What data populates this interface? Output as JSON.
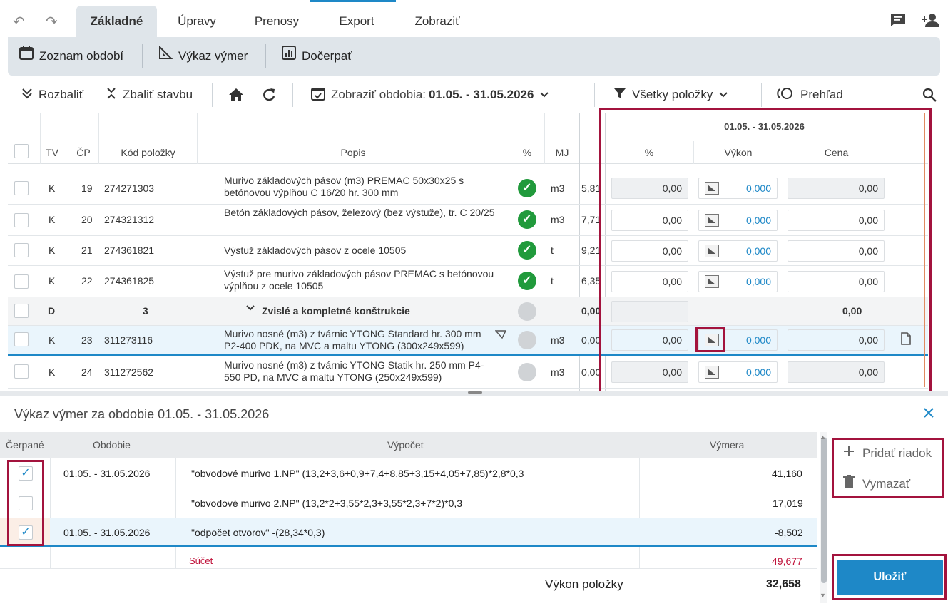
{
  "menu": {
    "tabs": [
      "Základné",
      "Úpravy",
      "Prenosy",
      "Export",
      "Zobraziť"
    ],
    "active_tab": "Základné"
  },
  "ribbon": {
    "zoznam": "Zoznam období",
    "vykaz": "Výkaz výmer",
    "docerpat": "Dočerpať"
  },
  "toolbar": {
    "rozbalit": "Rozbaliť",
    "zbalit": "Zbaliť stavbu",
    "zobrazit_prefix": "Zobraziť obdobia:",
    "zobrazit_value": "01.05. - 31.05.2026",
    "filter": "Všetky položky",
    "prehlad": "Prehľad"
  },
  "grid": {
    "headers": {
      "tv": "TV",
      "cp": "ČP",
      "kod": "Kód položky",
      "popis": "Popis",
      "pct": "%",
      "mj": "MJ"
    },
    "period_header": "01.05. - 31.05.2026",
    "period_cols": {
      "pct": "%",
      "vykon": "Výkon",
      "cena": "Cena"
    },
    "rows": [
      {
        "tv": "K",
        "cp": "19",
        "kod": "274271303",
        "popis": "Murivo základových pásov (m3) PREMAC 50x30x25 s betónovou výplňou C 16/20 hr. 300 mm",
        "mj": "m3",
        "prev": "5,81",
        "pct": "0,00",
        "vykon": "0,000",
        "cena": "0,00"
      },
      {
        "tv": "K",
        "cp": "20",
        "kod": "274321312",
        "popis": "Betón základových pásov, železový (bez výstuže), tr. C 20/25",
        "mj": "m3",
        "prev": "7,71",
        "pct": "0,00",
        "vykon": "0,000",
        "cena": "0,00"
      },
      {
        "tv": "K",
        "cp": "21",
        "kod": "274361821",
        "popis": "Výstuž základových pásov z ocele 10505",
        "mj": "t",
        "prev": "9,21",
        "pct": "0,00",
        "vykon": "0,000",
        "cena": "0,00"
      },
      {
        "tv": "K",
        "cp": "22",
        "kod": "274361825",
        "popis": "Výstuž pre murivo základových pásov PREMAC s betónovou výplňou z ocele 10505",
        "mj": "t",
        "prev": "6,35",
        "pct": "0,00",
        "vykon": "0,000",
        "cena": "0,00"
      },
      {
        "tv": "D",
        "cp": "3",
        "kod": "",
        "popis": "Zvislé a kompletné konštrukcie",
        "mj": "",
        "prev": "0,00",
        "pct": "",
        "vykon": "",
        "cena": "0,00"
      },
      {
        "tv": "K",
        "cp": "23",
        "kod": "311273116",
        "popis": "Murivo nosné (m3) z tvárnic YTONG Standard hr. 300 mm P2-400 PDK, na MVC a maltu YTONG (300x249x599)",
        "mj": "m3",
        "prev": "0,00",
        "pct": "0,00",
        "vykon": "0,000",
        "cena": "0,00"
      },
      {
        "tv": "K",
        "cp": "24",
        "kod": "311272562",
        "popis": "Murivo nosné (m3) z tvárnic YTONG Statik hr. 250 mm P4-550 PD, na MVC a maltu YTONG (250x249x599)",
        "mj": "m3",
        "prev": "0,00",
        "pct": "0,00",
        "vykon": "0,000",
        "cena": "0,00"
      }
    ]
  },
  "panel": {
    "title": "Výkaz výmer za obdobie 01.05. - 31.05.2026",
    "headers": {
      "cerpane": "Čerpané",
      "obdobie": "Obdobie",
      "vypocet": "Výpočet",
      "vymera": "Výmera"
    },
    "rows": [
      {
        "checked": true,
        "obdobie": "01.05. - 31.05.2026",
        "vypocet": "\"obvodové murivo 1.NP\" (13,2+3,6+0,9+7,4+8,85+3,15+4,05+7,85)*2,8*0,3",
        "vymera": "41,160"
      },
      {
        "checked": false,
        "obdobie": "",
        "vypocet": "\"obvodové murivo 2.NP\" (13,2*2+3,55*2,3+3,55*2,3+7*2)*0,3",
        "vymera": "17,019"
      },
      {
        "checked": true,
        "obdobie": "01.05. - 31.05.2026",
        "vypocet": "\"odpočet otvorov\" -(28,34*0,3)",
        "vymera": "-8,502"
      }
    ],
    "sucet_label": "Súčet",
    "sucet_value": "49,677",
    "vykon_label": "Výkon položky",
    "vykon_value": "32,658",
    "add_row": "Pridať riadok",
    "delete": "Vymazať",
    "save": "Uložiť"
  },
  "colors": {
    "accent": "#1e88c7",
    "highlight_box": "#a3133d",
    "check_green": "#219a3c",
    "sum_red": "#c0143c"
  }
}
